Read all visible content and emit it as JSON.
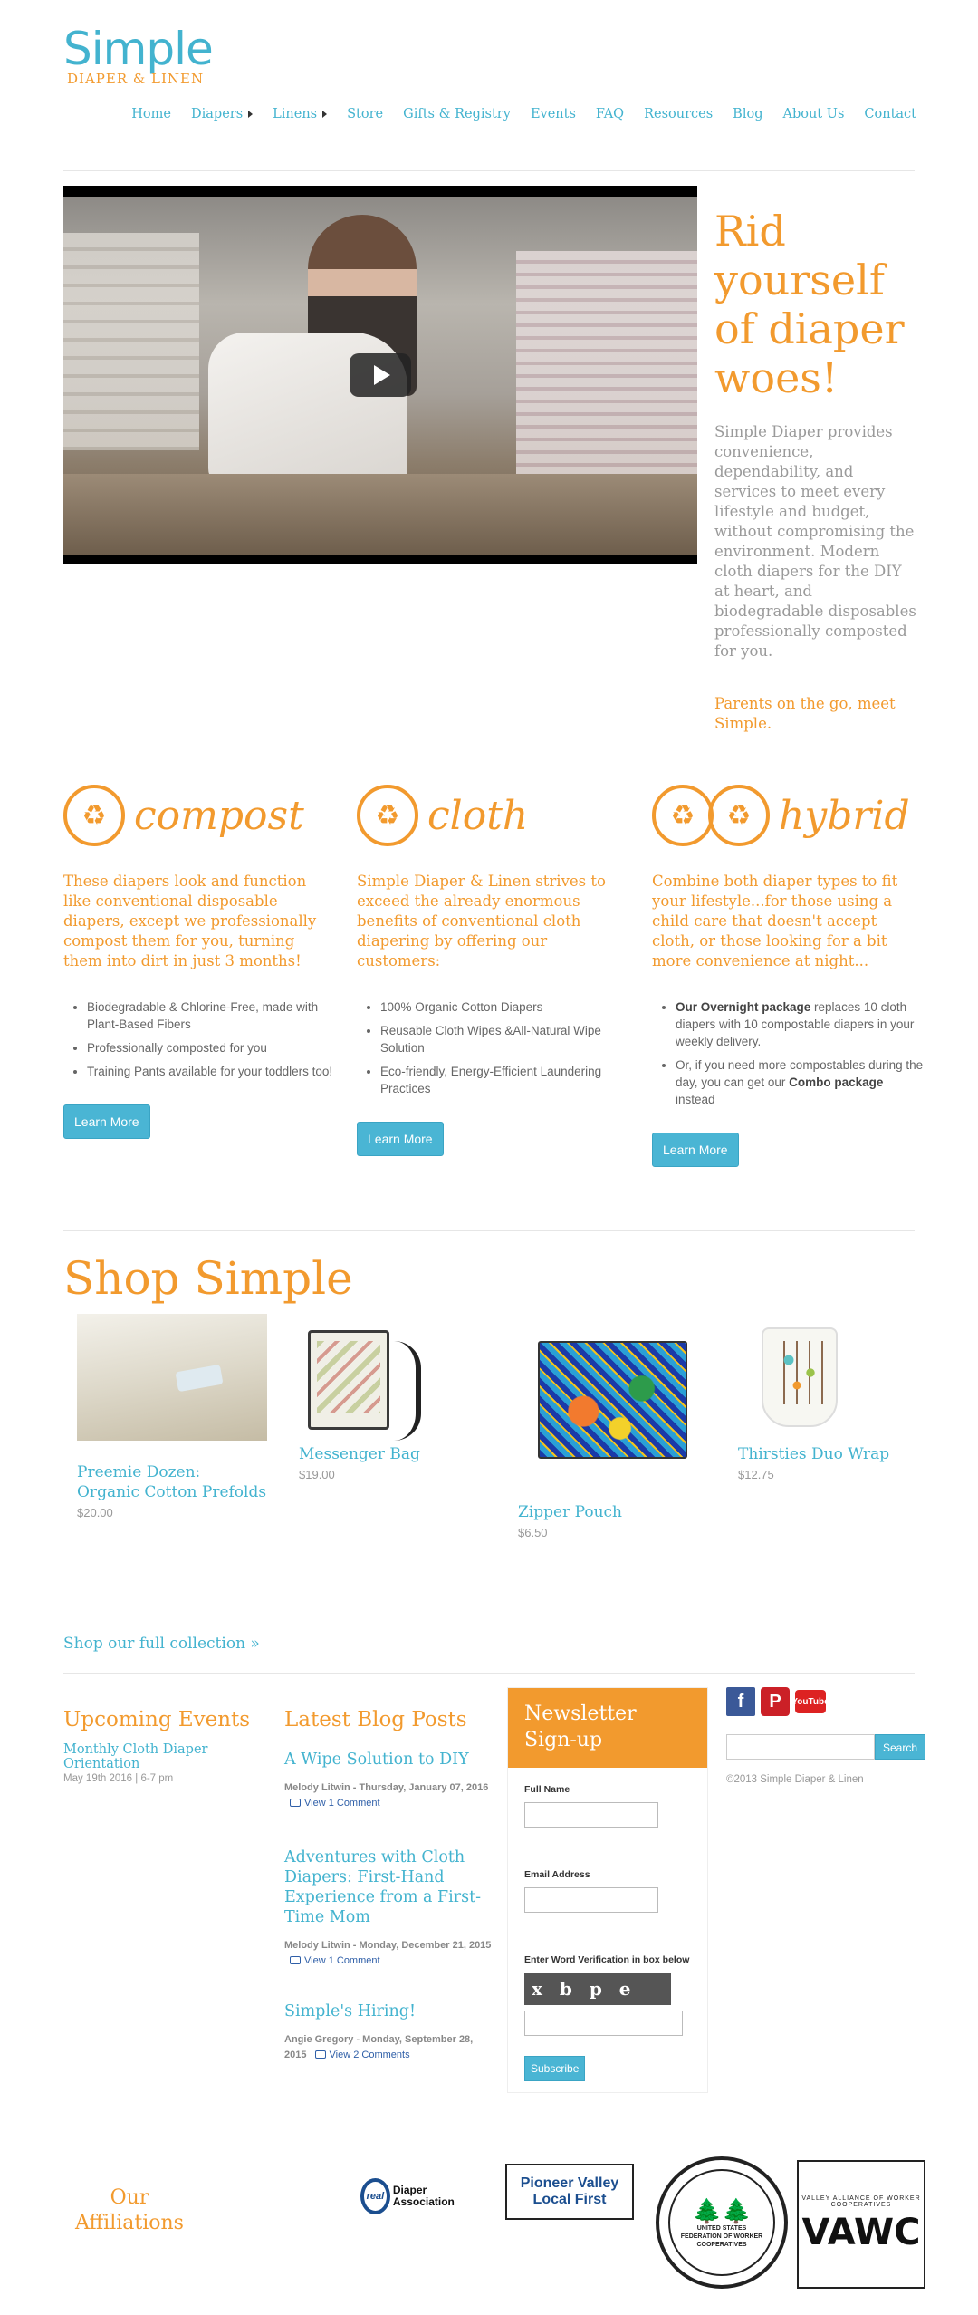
{
  "brand": {
    "name": "Simple",
    "tagline": "DIAPER & LINEN"
  },
  "colors": {
    "accent": "#f29a2e",
    "link": "#43b3cf",
    "button": "#4ab5d4"
  },
  "nav": [
    {
      "label": "Home",
      "has_caret": false
    },
    {
      "label": "Diapers",
      "has_caret": true
    },
    {
      "label": "Linens",
      "has_caret": true
    },
    {
      "label": "Store",
      "has_caret": false
    },
    {
      "label": "Gifts & Registry",
      "has_caret": false
    },
    {
      "label": "Events",
      "has_caret": false
    },
    {
      "label": "FAQ",
      "has_caret": false
    },
    {
      "label": "Resources",
      "has_caret": false
    },
    {
      "label": "Blog",
      "has_caret": false
    },
    {
      "label": "About Us",
      "has_caret": false
    },
    {
      "label": "Contact",
      "has_caret": false
    }
  ],
  "hero": {
    "title": "Rid yourself of diaper woes!",
    "body": "Simple Diaper provides convenience, dependability, and services to meet every lifestyle and budget, without compromising the environment. Modern cloth diapers for the DIY at heart, and biodegradable disposables professionally composted for you.",
    "link": "Parents on the go, meet Simple."
  },
  "services": [
    {
      "word": "compost",
      "lead": "These diapers look and function like conventional disposable diapers, except we professionally compost them for you, turning them into dirt in just 3 months!",
      "items": [
        "Biodegradable & Chlorine-Free, made with Plant-Based Fibers",
        "Professionally composted for you",
        "Training Pants available for your toddlers too!"
      ],
      "button": "Learn More"
    },
    {
      "word": "cloth",
      "lead": "Simple Diaper & Linen strives to exceed the already enormous benefits of conventional cloth diapering by offering our customers:",
      "items": [
        "100% Organic Cotton Diapers",
        "Reusable Cloth Wipes &All-Natural Wipe Solution",
        "Eco-friendly, Energy-Efficient Laundering Practices"
      ],
      "button": "Learn More"
    },
    {
      "word": "hybrid",
      "lead": "Combine both diaper types to fit your lifestyle...for those using a child care that doesn't accept cloth, or those looking for a bit more convenience at night...",
      "item1_bold": "Our Overnight package",
      "item1_rest": " replaces 10 cloth diapers with 10 compostable diapers in your weekly delivery.",
      "item2_start": "Or, if you need more compostables during the day, you can get our ",
      "item2_bold": "Combo package",
      "item2_end": " instead",
      "button": "Learn More"
    }
  ],
  "shop": {
    "title": "Shop Simple",
    "products": [
      {
        "name": "Preemie Dozen: Organic Cotton Prefolds",
        "price": "$20.00"
      },
      {
        "name": "Messenger Bag",
        "price": "$19.00"
      },
      {
        "name": "Zipper Pouch",
        "price": "$6.50"
      },
      {
        "name": "Thirsties Duo Wrap",
        "price": "$12.75"
      }
    ],
    "all_link": "Shop our full collection »"
  },
  "events": {
    "title": "Upcoming Events",
    "items": [
      {
        "name": "Monthly Cloth Diaper Orientation",
        "date": "May 19th 2016 | 6-7 pm"
      }
    ]
  },
  "blog": {
    "title": "Latest Blog Posts",
    "posts": [
      {
        "title": "A Wipe Solution to DIY",
        "meta": "Melody Litwin - Thursday, January 07, 2016",
        "comments": "View 1 Comment"
      },
      {
        "title": "Adventures with Cloth Diapers: First-Hand Experience from a First-Time Mom",
        "meta": "Melody Litwin - Monday, December 21, 2015",
        "comments": "View 1 Comment"
      },
      {
        "title": "Simple's Hiring!",
        "meta": "Angie Gregory - Monday, September 28, 2015",
        "comments": "View 2 Comments"
      }
    ]
  },
  "newsletter": {
    "title": "Newsletter Sign-up",
    "full_name_label": "Full Name",
    "email_label": "Email Address",
    "verify_label": "Enter Word Verification in box below",
    "captcha": "xbpevv",
    "button": "Subscribe"
  },
  "social": {
    "icons": [
      "facebook-icon",
      "pinterest-icon",
      "youtube-icon"
    ],
    "youtube_text": "YouTube",
    "search_button": "Search",
    "copyright": "©2013 Simple Diaper & Linen"
  },
  "affiliations": {
    "title": "Our Affiliations",
    "rda_badge": "real",
    "rda": "Diaper Association",
    "pv_line1": "Pioneer Valley",
    "pv_line2": "Local First",
    "usf": "UNITED STATES FEDERATION OF WORKER COOPERATIVES",
    "vawc_arc": "VALLEY ALLIANCE OF WORKER COOPERATIVES",
    "vawc": "VAWC"
  }
}
